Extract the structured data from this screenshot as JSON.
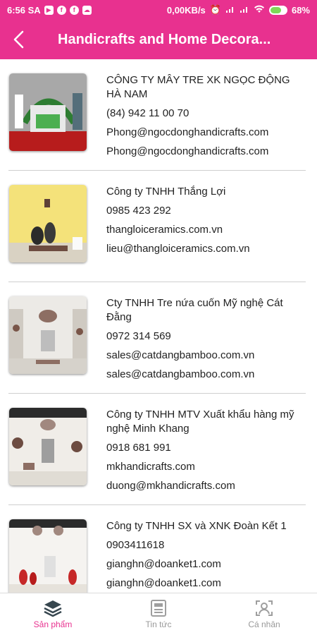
{
  "status_bar": {
    "time": "6:56 SA",
    "network_speed": "0,00KB/s",
    "battery": "68%",
    "battery_level": 0.68,
    "notification_icons": [
      "youtube-icon",
      "facebook-icon",
      "facebook-icon",
      "cloud-icon"
    ]
  },
  "header": {
    "title": "Handicrafts and Home Decora...",
    "back_icon": "back-arrow-icon",
    "background": "#e8318f"
  },
  "companies": [
    {
      "name": "CÔNG TY MÂY TRE XK NGỌC ĐỘNG HÀ NAM",
      "phone": "(84) 942 11 00 70",
      "website": "Phong@ngocdonghandicrafts.com",
      "email": "Phong@ngocdonghandicrafts.com"
    },
    {
      "name": "Công ty TNHH Thắng Lợi",
      "phone": "0985 423 292",
      "website": "thangloiceramics.com.vn",
      "email": "lieu@thangloiceramics.com.vn"
    },
    {
      "name": "Cty TNHH Tre nứa cuốn Mỹ nghệ Cát Đằng",
      "phone": "0972 314 569",
      "website": "sales@catdangbamboo.com.vn",
      "email": "sales@catdangbamboo.com.vn"
    },
    {
      "name": "Công ty TNHH MTV Xuất khẩu hàng mỹ nghệ Minh Khang",
      "phone": "0918 681 991",
      "website": "mkhandicrafts.com",
      "email": "duong@mkhandicrafts.com"
    },
    {
      "name": "Công ty TNHH SX và XNK Đoàn Kết 1",
      "phone": "0903411618",
      "website": "gianghn@doanket1.com",
      "email": "gianghn@doanket1.com"
    }
  ],
  "bottom_nav": [
    {
      "label": "Sản phẩm",
      "icon": "layers-icon",
      "active": true
    },
    {
      "label": "Tin tức",
      "icon": "news-icon",
      "active": false
    },
    {
      "label": "Cá nhân",
      "icon": "profile-icon",
      "active": false
    }
  ],
  "colors": {
    "accent": "#e8318f",
    "active_nav": "#e8318f",
    "inactive_nav": "#999999",
    "divider": "#cfcfcf"
  }
}
